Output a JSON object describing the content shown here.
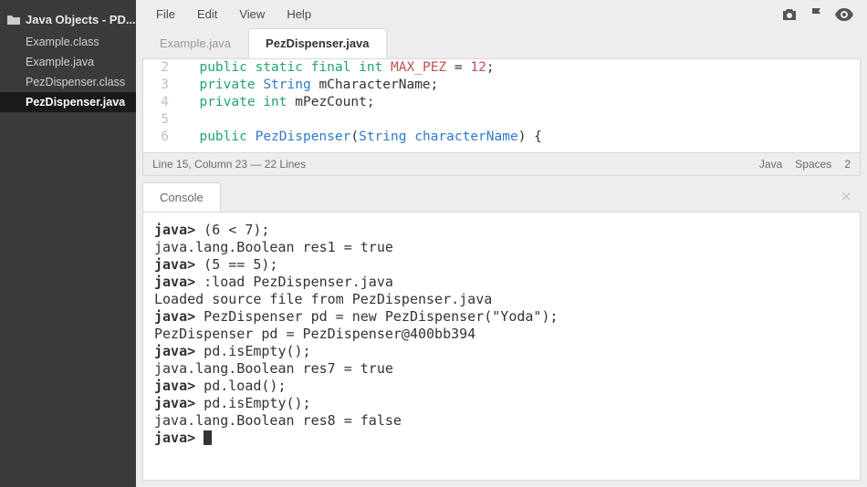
{
  "sidebar": {
    "project": "Java Objects - PD...",
    "files": [
      {
        "name": "Example.class",
        "selected": false
      },
      {
        "name": "Example.java",
        "selected": false
      },
      {
        "name": "PezDispenser.class",
        "selected": false
      },
      {
        "name": "PezDispenser.java",
        "selected": true
      }
    ]
  },
  "menu": {
    "items": [
      "File",
      "Edit",
      "View",
      "Help"
    ]
  },
  "tabs": [
    {
      "label": "Example.java",
      "active": false
    },
    {
      "label": "PezDispenser.java",
      "active": true
    }
  ],
  "editor": {
    "lines": [
      {
        "n": 2,
        "tokens": [
          {
            "t": "  ",
            "c": ""
          },
          {
            "t": "public",
            "c": "kw-public"
          },
          {
            "t": " ",
            "c": ""
          },
          {
            "t": "static",
            "c": "kw-static"
          },
          {
            "t": " ",
            "c": ""
          },
          {
            "t": "final",
            "c": "kw-final"
          },
          {
            "t": " ",
            "c": ""
          },
          {
            "t": "int",
            "c": "kw-int"
          },
          {
            "t": " ",
            "c": ""
          },
          {
            "t": "MAX_PEZ",
            "c": "const"
          },
          {
            "t": " = ",
            "c": "punc"
          },
          {
            "t": "12",
            "c": "num"
          },
          {
            "t": ";",
            "c": "punc"
          }
        ]
      },
      {
        "n": 3,
        "tokens": [
          {
            "t": "  ",
            "c": ""
          },
          {
            "t": "private",
            "c": "kw-private"
          },
          {
            "t": " ",
            "c": ""
          },
          {
            "t": "String",
            "c": "typ"
          },
          {
            "t": " ",
            "c": ""
          },
          {
            "t": "mCharacterName",
            "c": "ident"
          },
          {
            "t": ";",
            "c": "punc"
          }
        ]
      },
      {
        "n": 4,
        "tokens": [
          {
            "t": "  ",
            "c": ""
          },
          {
            "t": "private",
            "c": "kw-private"
          },
          {
            "t": " ",
            "c": ""
          },
          {
            "t": "int",
            "c": "kw-int"
          },
          {
            "t": " ",
            "c": ""
          },
          {
            "t": "mPezCount",
            "c": "ident"
          },
          {
            "t": ";",
            "c": "punc"
          }
        ]
      },
      {
        "n": 5,
        "tokens": []
      },
      {
        "n": 6,
        "tokens": [
          {
            "t": "  ",
            "c": ""
          },
          {
            "t": "public",
            "c": "kw-public"
          },
          {
            "t": " ",
            "c": ""
          },
          {
            "t": "PezDispenser",
            "c": "typ"
          },
          {
            "t": "(",
            "c": "punc"
          },
          {
            "t": "String",
            "c": "param"
          },
          {
            "t": " ",
            "c": ""
          },
          {
            "t": "characterName",
            "c": "param"
          },
          {
            "t": ")",
            "c": "punc"
          },
          {
            "t": " {",
            "c": "punc"
          }
        ]
      }
    ]
  },
  "status": {
    "pos": "Line 15, Column 23 — 22 Lines",
    "lang": "Java",
    "indent": "Spaces",
    "indentn": "2"
  },
  "console": {
    "tab": "Console",
    "lines": [
      {
        "prompt": "java>",
        "text": " (6 < 7);"
      },
      {
        "prompt": "",
        "text": "java.lang.Boolean res1 = true"
      },
      {
        "prompt": "java>",
        "text": " (5 == 5);"
      },
      {
        "prompt": "java>",
        "text": " :load PezDispenser.java"
      },
      {
        "prompt": "",
        "text": "Loaded source file from PezDispenser.java"
      },
      {
        "prompt": "java>",
        "text": " PezDispenser pd = new PezDispenser(\"Yoda\");"
      },
      {
        "prompt": "",
        "text": "PezDispenser pd = PezDispenser@400bb394"
      },
      {
        "prompt": "java>",
        "text": " pd.isEmpty();"
      },
      {
        "prompt": "",
        "text": "java.lang.Boolean res7 = true"
      },
      {
        "prompt": "java>",
        "text": " pd.load();"
      },
      {
        "prompt": "",
        "text": ""
      },
      {
        "prompt": "java>",
        "text": " pd.isEmpty();"
      },
      {
        "prompt": "",
        "text": "java.lang.Boolean res8 = false"
      },
      {
        "prompt": "java>",
        "text": " ",
        "cursor": true
      }
    ]
  }
}
